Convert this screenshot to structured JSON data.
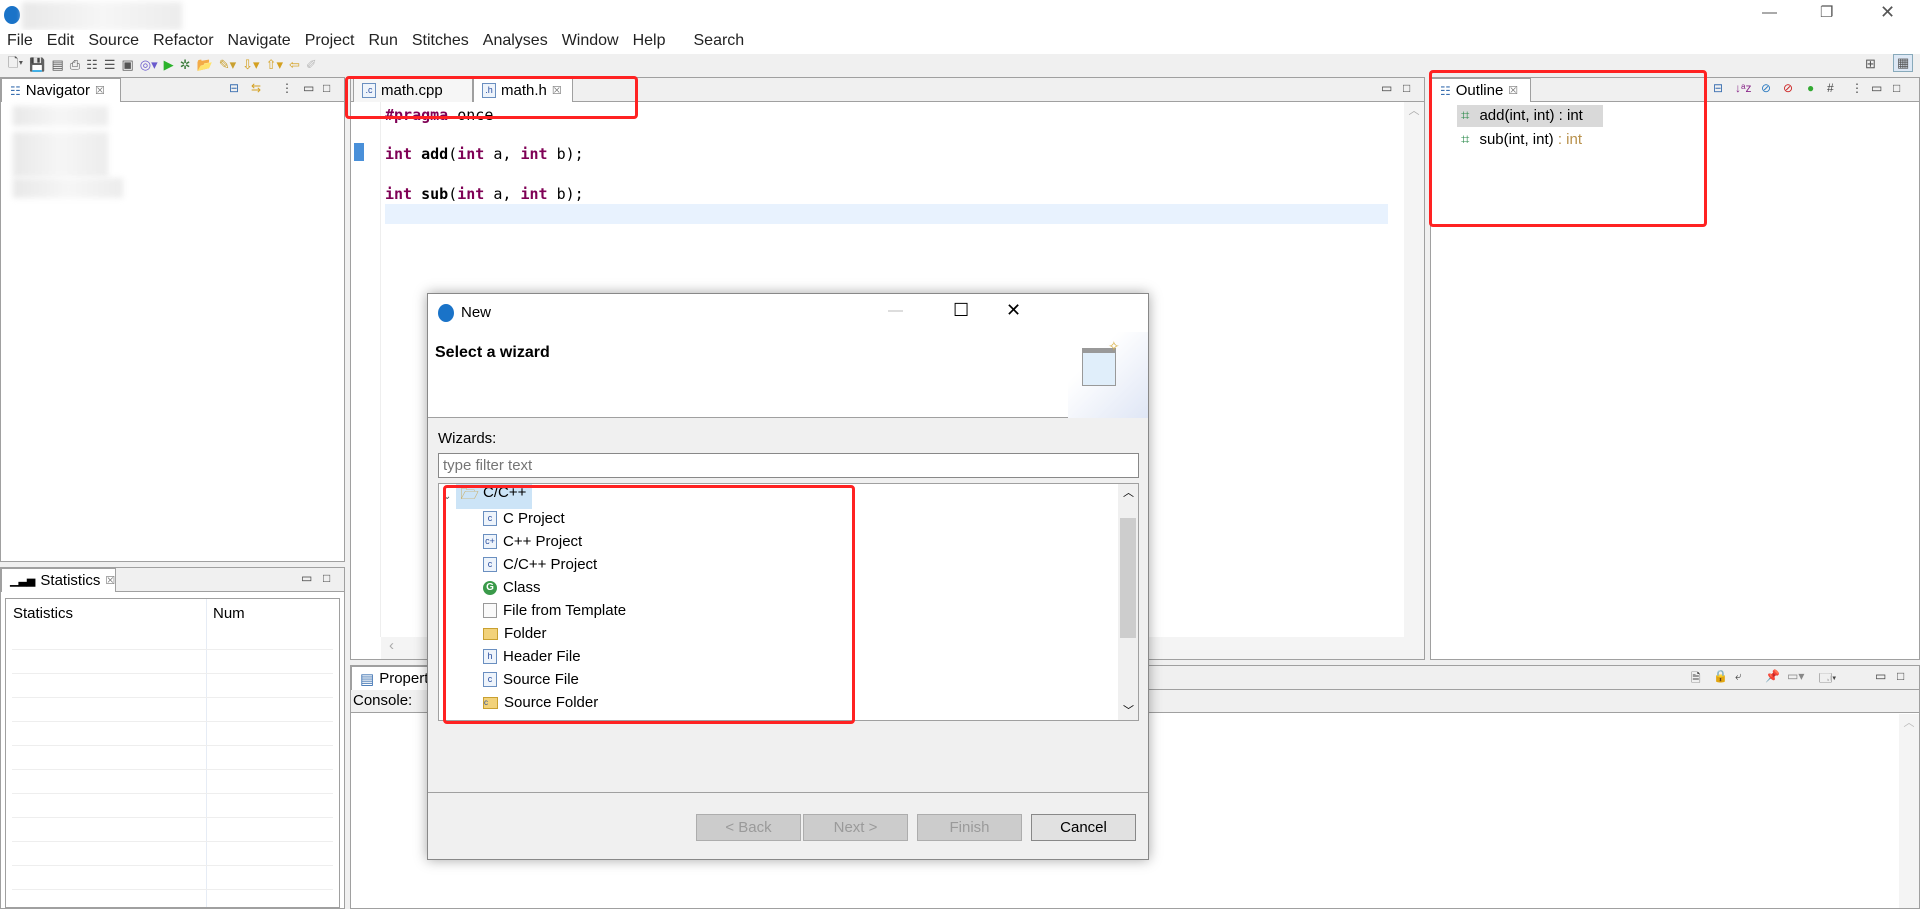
{
  "menu": [
    "File",
    "Edit",
    "Source",
    "Refactor",
    "Navigate",
    "Project",
    "Run",
    "Stitches",
    "Analyses",
    "Window",
    "Help",
    "Search"
  ],
  "navigator": {
    "title": "Navigator"
  },
  "editor": {
    "tabs": [
      "math.cpp",
      "math.h"
    ],
    "active_tab": "math.h",
    "lines": {
      "pragma": "#pragma",
      "once": " once",
      "l2_int": "int",
      "l2_fn": " add",
      "l2_rest1": "(",
      "l2_int2": "int",
      "l2_rest2": " a, ",
      "l2_int3": "int",
      "l2_rest3": " b);",
      "l3_int": "int",
      "l3_fn": " sub",
      "l3_rest1": "(",
      "l3_int2": "int",
      "l3_rest2": " a, ",
      "l3_int3": "int",
      "l3_rest3": " b);"
    }
  },
  "outline": {
    "title": "Outline",
    "items": [
      {
        "name": "add(int, int)",
        "type": " : int"
      },
      {
        "name": "sub(int, int)",
        "type": " : int"
      }
    ]
  },
  "statistics": {
    "title": "Statistics",
    "columns": [
      "Statistics",
      "Num"
    ]
  },
  "properties": {
    "title": "Propert",
    "console_label": "Console:"
  },
  "dialog": {
    "title": "New",
    "heading": "Select a wizard",
    "wizards_label": "Wizards:",
    "filter_placeholder": "type filter text",
    "category": "C/C++",
    "items": [
      {
        "label": "C Project",
        "icon": "c"
      },
      {
        "label": "C++ Project",
        "icon": "c+"
      },
      {
        "label": "C/C++ Project",
        "icon": "c"
      },
      {
        "label": "Class",
        "icon": "G"
      },
      {
        "label": "File from Template",
        "icon": ""
      },
      {
        "label": "Folder",
        "icon": "folder"
      },
      {
        "label": "Header File",
        "icon": "h"
      },
      {
        "label": "Source File",
        "icon": "c"
      },
      {
        "label": "Source Folder",
        "icon": "src"
      }
    ],
    "buttons": {
      "back": "< Back",
      "next": "Next >",
      "finish": "Finish",
      "cancel": "Cancel"
    }
  },
  "colors": {
    "highlight": "#f22222",
    "keyword": "#7f0055",
    "accent": "#1a73c8"
  }
}
